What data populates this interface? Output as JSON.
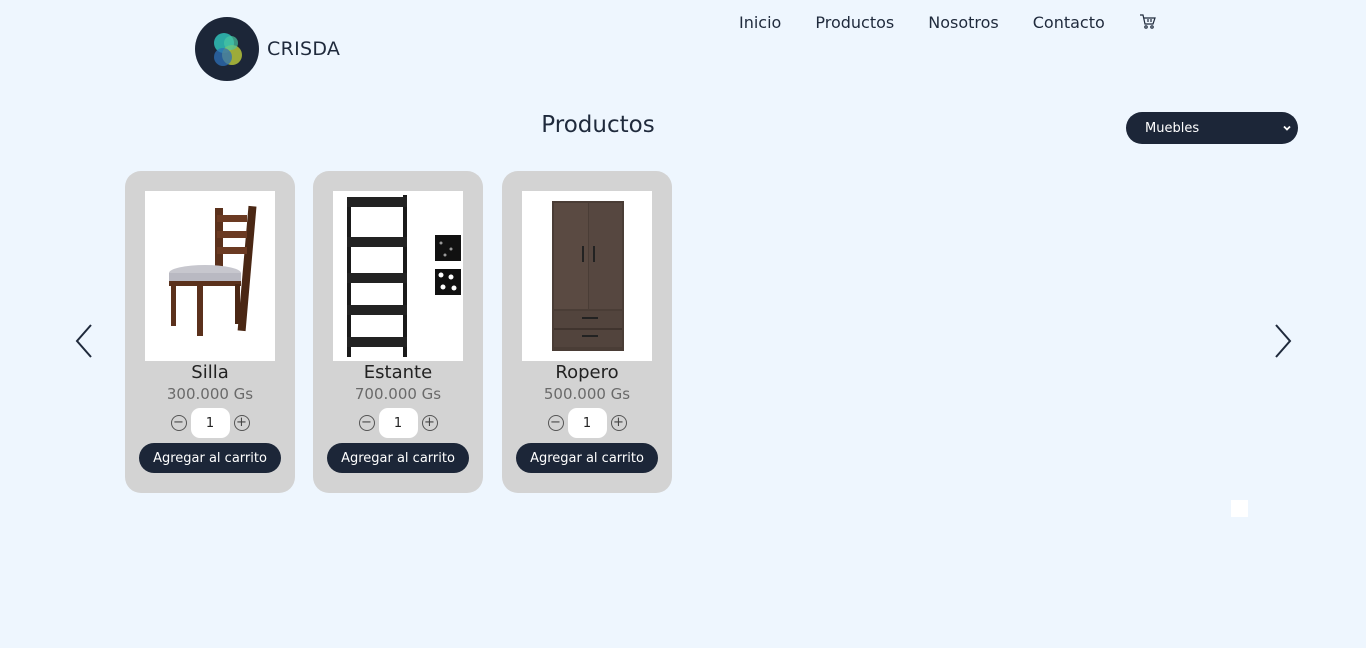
{
  "brand": {
    "name": "CRISDA",
    "logo_icon": "crisda-logo-icon"
  },
  "nav": {
    "items": [
      "Inicio",
      "Productos",
      "Nosotros",
      "Contacto"
    ],
    "cart_icon": "cart-icon"
  },
  "page": {
    "title": "Productos"
  },
  "filter": {
    "selected": "Muebles"
  },
  "carousel": {
    "prev_icon": "chevron-left-icon",
    "next_icon": "chevron-right-icon"
  },
  "products": [
    {
      "name": "Silla",
      "price": "300.000 Gs",
      "qty": "1",
      "add_label": "Agregar al carrito",
      "image": "chair-image"
    },
    {
      "name": "Estante",
      "price": "700.000 Gs",
      "qty": "1",
      "add_label": "Agregar al carrito",
      "image": "shelf-image"
    },
    {
      "name": "Ropero",
      "price": "500.000 Gs",
      "qty": "1",
      "add_label": "Agregar al carrito",
      "image": "wardrobe-image"
    }
  ],
  "colors": {
    "background": "#eef6fe",
    "primary": "#1c2638",
    "card": "#d3d3d3"
  }
}
